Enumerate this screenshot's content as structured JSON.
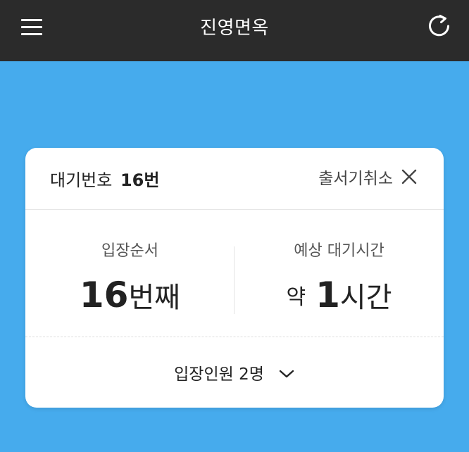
{
  "header": {
    "title": "진영면옥",
    "menu_icon": "hamburger-menu-icon",
    "refresh_icon": "refresh-icon"
  },
  "ticket": {
    "label": "대기번호",
    "number": "16번",
    "cancel_label": "출서기취소",
    "cancel_icon": "close-icon"
  },
  "queue": {
    "position_label": "입장순서",
    "position_value": "16",
    "position_unit": "번째"
  },
  "wait": {
    "label": "예상 대기시간",
    "prefix": "약",
    "value": "1",
    "unit": "시간"
  },
  "party": {
    "label": "입장인원 2명",
    "chevron_icon": "chevron-down-icon"
  },
  "colors": {
    "topbar": "#2b2b2b",
    "background": "#46abed",
    "card": "#ffffff"
  }
}
